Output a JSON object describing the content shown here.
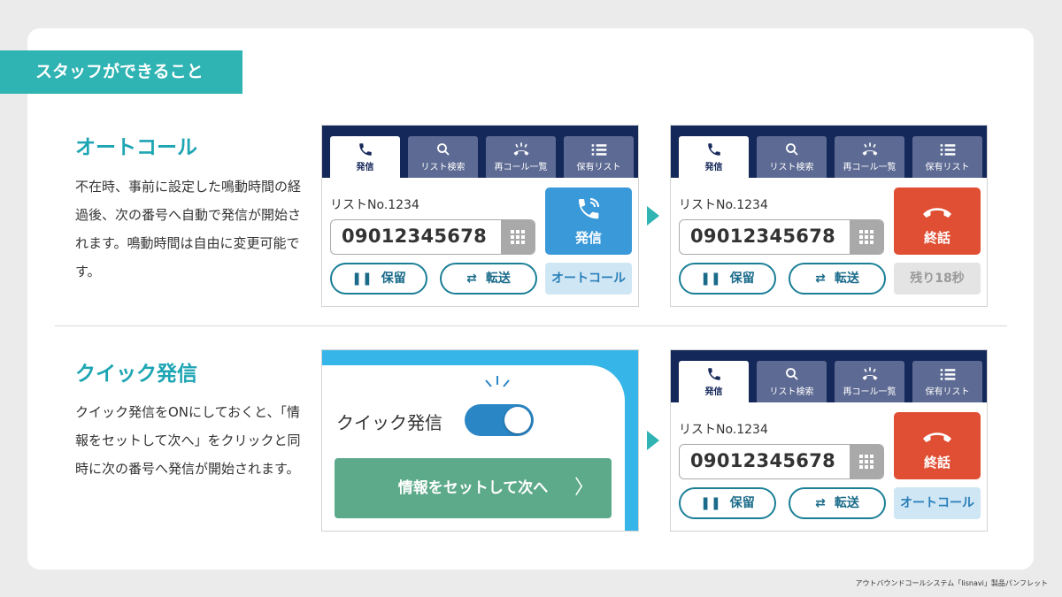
{
  "banner": "スタッフができること",
  "sections": {
    "auto": {
      "title": "オートコール",
      "desc": "不在時、事前に設定した鳴動時間の経過後、次の番号へ自動で発信が開始されます。鳴動時間は自由に変更可能です。"
    },
    "quick": {
      "title": "クイック発信",
      "desc": "クイック発信をONにしておくと、「情報をセットして次へ」をクリックと同時に次の番号へ発信が開始されます。"
    }
  },
  "tabs": [
    "発信",
    "リスト検索",
    "再コール一覧",
    "保有リスト"
  ],
  "phone": {
    "list_no": "リストNo.1234",
    "number": "09012345678",
    "call_label": "発信",
    "end_label": "終話",
    "hold_label": "保留",
    "transfer_label": "転送",
    "autocall_label": "オートコール",
    "remaining_label": "残り18秒"
  },
  "quick_panel": {
    "label": "クイック発信",
    "toggle_on": true,
    "next_button": "情報をセットして次へ"
  },
  "footer": "アウトバウンドコールシステム「lisnavi」製品パンフレット",
  "colors": {
    "teal": "#2fb3b3",
    "navy": "#15285a",
    "call_blue": "#3a9ad9",
    "end_red": "#e04e33",
    "next_green": "#5daa8b"
  }
}
